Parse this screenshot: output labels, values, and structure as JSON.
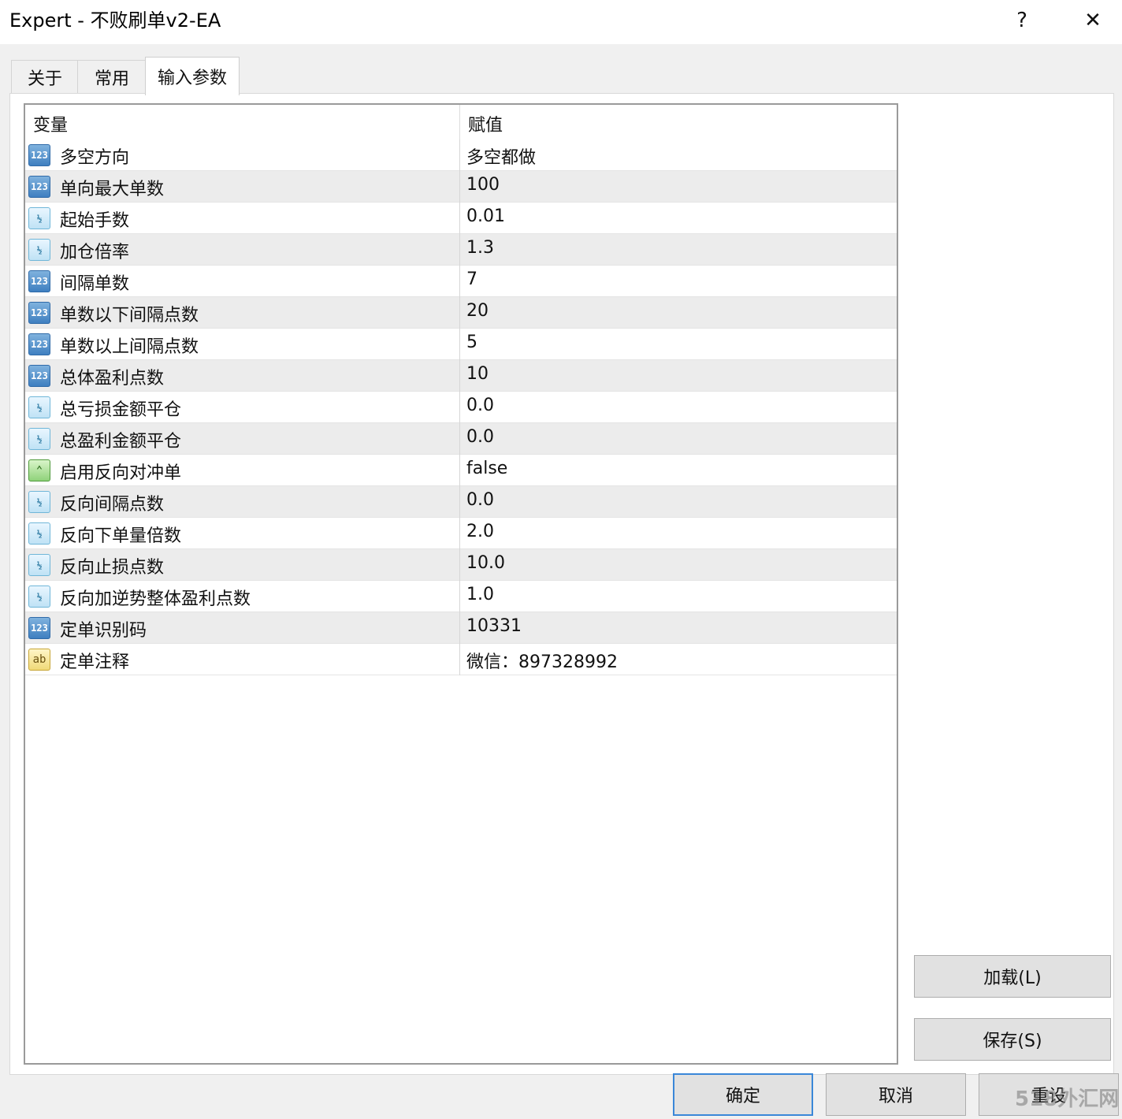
{
  "window": {
    "title": "Expert - 不败刷单v2-EA",
    "help_symbol": "?",
    "close_symbol": "✕"
  },
  "tabs": [
    {
      "label": "关于",
      "active": false
    },
    {
      "label": "常用",
      "active": false
    },
    {
      "label": "输入参数",
      "active": true
    }
  ],
  "grid": {
    "columns": {
      "variable": "变量",
      "value": "赋值"
    },
    "rows": [
      {
        "type_icon": "int-icon",
        "icon_text": "123",
        "name": "多空方向",
        "value": "多空都做"
      },
      {
        "type_icon": "int-icon",
        "icon_text": "123",
        "name": "单向最大单数",
        "value": "100"
      },
      {
        "type_icon": "double-icon",
        "icon_text": "½",
        "name": "起始手数",
        "value": "0.01"
      },
      {
        "type_icon": "double-icon",
        "icon_text": "½",
        "name": "加仓倍率",
        "value": "1.3"
      },
      {
        "type_icon": "int-icon",
        "icon_text": "123",
        "name": "间隔单数",
        "value": "7"
      },
      {
        "type_icon": "int-icon",
        "icon_text": "123",
        "name": "单数以下间隔点数",
        "value": "20"
      },
      {
        "type_icon": "int-icon",
        "icon_text": "123",
        "name": "单数以上间隔点数",
        "value": "5"
      },
      {
        "type_icon": "int-icon",
        "icon_text": "123",
        "name": "总体盈利点数",
        "value": "10"
      },
      {
        "type_icon": "double-icon",
        "icon_text": "½",
        "name": "总亏损金额平仓",
        "value": "0.0"
      },
      {
        "type_icon": "double-icon",
        "icon_text": "½",
        "name": "总盈利金额平仓",
        "value": "0.0"
      },
      {
        "type_icon": "bool-icon",
        "icon_text": "⌃",
        "name": "启用反向对冲单",
        "value": "false"
      },
      {
        "type_icon": "double-icon",
        "icon_text": "½",
        "name": "反向间隔点数",
        "value": "0.0"
      },
      {
        "type_icon": "double-icon",
        "icon_text": "½",
        "name": "反向下单量倍数",
        "value": "2.0"
      },
      {
        "type_icon": "double-icon",
        "icon_text": "½",
        "name": "反向止损点数",
        "value": "10.0"
      },
      {
        "type_icon": "double-icon",
        "icon_text": "½",
        "name": "反向加逆势整体盈利点数",
        "value": "1.0"
      },
      {
        "type_icon": "int-icon",
        "icon_text": "123",
        "name": "定单识别码",
        "value": "10331"
      },
      {
        "type_icon": "string-icon",
        "icon_text": "ab",
        "name": "定单注释",
        "value": "微信：897328992"
      }
    ]
  },
  "buttons": {
    "load": "加载(L)",
    "save": "保存(S)",
    "ok": "确定",
    "cancel": "取消",
    "reset": "重设"
  },
  "watermark": "518外汇网"
}
